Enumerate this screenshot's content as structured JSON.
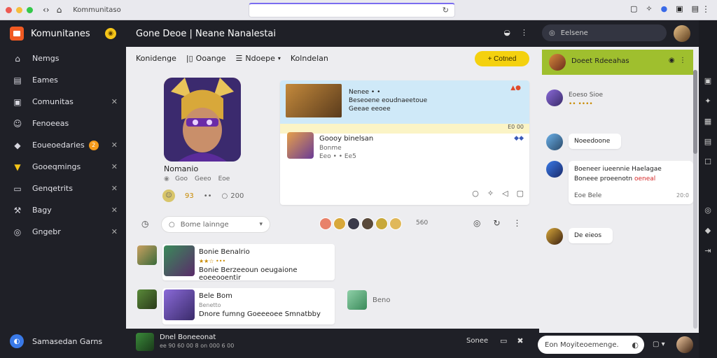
{
  "browser": {
    "app_title": "Kommunitaso",
    "colors": {
      "close": "#ee5a52",
      "min": "#f6bd3b",
      "max": "#34c84a"
    }
  },
  "sidebar": {
    "brand": "Komunitanes",
    "items": [
      {
        "label": "Nemgs",
        "icon": "home-icon",
        "closable": false
      },
      {
        "label": "Eames",
        "icon": "grid-icon",
        "closable": false
      },
      {
        "label": "Comunitas",
        "icon": "community-icon",
        "closable": true
      },
      {
        "label": "Fenoeeas",
        "icon": "friends-icon",
        "closable": false
      },
      {
        "label": "Eoueoedaries",
        "icon": "shield-icon",
        "closable": true,
        "badge": "2"
      },
      {
        "label": "Gooeqmings",
        "icon": "trophy-icon",
        "closable": true
      },
      {
        "label": "Genqetrits",
        "icon": "chat-icon",
        "closable": true
      },
      {
        "label": "Bagy",
        "icon": "wrench-icon",
        "closable": true
      },
      {
        "label": "Gngebr",
        "icon": "globe-icon",
        "closable": true
      }
    ],
    "footer": "Samasedan Garns"
  },
  "topbar": {
    "title": "Gone Deoe | Neane Nanalestai"
  },
  "main": {
    "tabs": [
      {
        "label": "Konidenge"
      },
      {
        "label": "Ooange",
        "icon": "file-icon"
      },
      {
        "label": "Ndoepe",
        "icon": "box-icon",
        "chevron": true
      },
      {
        "label": "Kolndelan"
      }
    ],
    "connect_label": "+ Cotned",
    "hero": {
      "name": "Nomanio",
      "meta": [
        "Goo",
        "Geeo",
        "Eoe"
      ],
      "stats": [
        "93",
        "••",
        "200"
      ]
    },
    "feature": {
      "banner_line1": "Nenee • •",
      "banner_line2": "Beseoene eoudnaeetoue",
      "banner_line3": "Geeae eeoee",
      "strip": "E0 00",
      "post_title": "Goooy binelsan",
      "post_line1": "Bonme",
      "post_line2": "Eeo   • • Ee5"
    },
    "filter": {
      "placeholder": "Bome lainnge",
      "count": "560"
    },
    "posts": [
      {
        "title": "Bonie Benalrio",
        "stars": "★★☆ •••",
        "text": "Bonie Berzeeoun oeugaione eoeeooentir"
      },
      {
        "title": "Bele Bom",
        "stars": "Benetto",
        "text": "Dnore fumng Goeeeoee Smnatbby"
      }
    ],
    "aside": "Beno"
  },
  "bottombar": {
    "title": "Dnel Boneeonat",
    "sub": "ee 90 60 00 8 on 000 6 00",
    "right": "Sonee"
  },
  "rightpanel": {
    "search": "Eelsene",
    "group": "Doeet Rdeeahas",
    "messages": [
      {
        "text": "Eoeso Sioe",
        "sub": "•• ••••",
        "plain": true
      },
      {
        "text": "Noeedoone",
        "plain": false
      },
      {
        "line1": "Boeneer iueennie Haelagae",
        "line2a": "Boneee proeenotn ",
        "line2b": "oeneal",
        "line3": "Eoe Bele",
        "time": "20:0",
        "plain": false
      },
      {
        "text": "De eieos",
        "plain": false
      }
    ],
    "input_placeholder": "Eon   Moyiteoemenge."
  }
}
